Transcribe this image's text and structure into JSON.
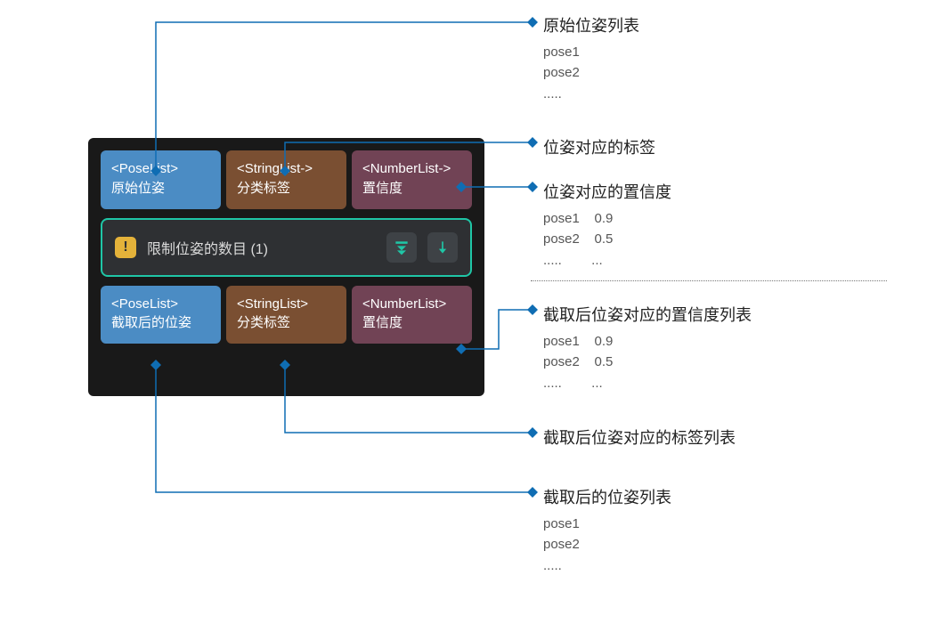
{
  "panel": {
    "inputs": [
      {
        "type": "<PoseList>",
        "label": "原始位姿"
      },
      {
        "type": "<StringList->",
        "label": "分类标签"
      },
      {
        "type": "<NumberList->",
        "label": "置信度"
      }
    ],
    "step": {
      "label": "限制位姿的数目 (1)"
    },
    "outputs": [
      {
        "type": "<PoseList>",
        "label": "截取后的位姿"
      },
      {
        "type": "<StringList>",
        "label": "分类标签"
      },
      {
        "type": "<NumberList>",
        "label": "置信度"
      }
    ]
  },
  "annotations": {
    "a_input_pose": {
      "title": "原始位姿列表",
      "lines": [
        "pose1",
        "pose2",
        "....."
      ]
    },
    "a_input_label": {
      "title": "位姿对应的标签"
    },
    "a_input_conf": {
      "title": "位姿对应的置信度",
      "lines": [
        "pose1    0.9",
        "pose2    0.5",
        ".....        ..."
      ]
    },
    "a_out_conf": {
      "title": "截取后位姿对应的置信度列表",
      "lines": [
        "pose1    0.9",
        "pose2    0.5",
        ".....        ..."
      ]
    },
    "a_out_label": {
      "title": "截取后位姿对应的标签列表"
    },
    "a_out_pose": {
      "title": "截取后的位姿列表",
      "lines": [
        "pose1",
        "pose2",
        "....."
      ]
    }
  }
}
